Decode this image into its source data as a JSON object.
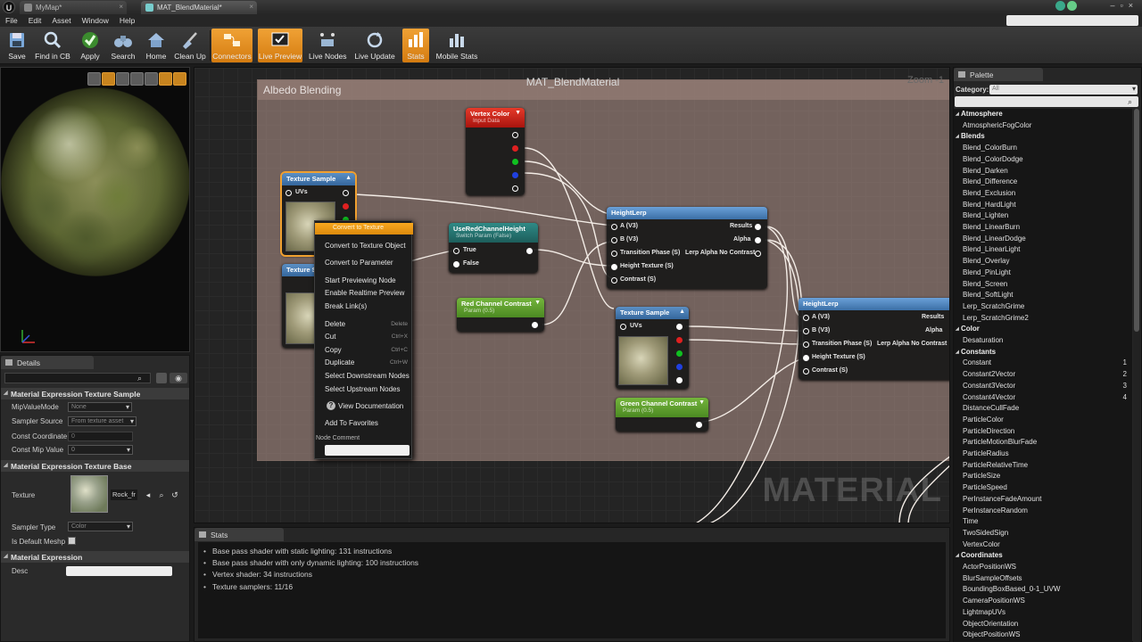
{
  "tabs": [
    {
      "label": "MyMap*"
    },
    {
      "label": "MAT_BlendMaterial*"
    }
  ],
  "menu": [
    "File",
    "Edit",
    "Asset",
    "Window",
    "Help"
  ],
  "toolbar": [
    {
      "label": "Save",
      "icon": "save-icon",
      "active": false
    },
    {
      "label": "Find in CB",
      "icon": "magnifier-icon",
      "active": false
    },
    {
      "label": "Apply",
      "icon": "checkmark-icon",
      "active": false
    },
    {
      "label": "Search",
      "icon": "binoculars-icon",
      "active": false
    },
    {
      "label": "Home",
      "icon": "home-icon",
      "active": false
    },
    {
      "label": "Clean Up",
      "icon": "broom-icon",
      "active": false
    },
    {
      "label": "Connectors",
      "icon": "connectors-icon",
      "active": true
    },
    {
      "label": "Live Preview",
      "icon": "live-preview-icon",
      "active": true
    },
    {
      "label": "Live Nodes",
      "icon": "live-nodes-icon",
      "active": false
    },
    {
      "label": "Live Update",
      "icon": "live-update-icon",
      "active": false
    },
    {
      "label": "Stats",
      "icon": "stats-icon",
      "active": true
    },
    {
      "label": "Mobile Stats",
      "icon": "mobile-stats-icon",
      "active": false
    }
  ],
  "details": {
    "tab": "Details",
    "sections": {
      "texture_sample": "Material Expression Texture Sample",
      "texture_base": "Material Expression Texture Base",
      "expression": "Material Expression"
    },
    "props": {
      "mip_value_mode": {
        "label": "MipValueMode",
        "value": "None"
      },
      "sampler_source": {
        "label": "Sampler Source",
        "value": "From texture asset"
      },
      "const_coordinate": {
        "label": "Const Coordinate",
        "value": "0"
      },
      "const_mip_value": {
        "label": "Const Mip Value",
        "value": "0"
      },
      "texture": {
        "label": "Texture",
        "value": "Rock_fr"
      },
      "sampler_type": {
        "label": "Sampler Type",
        "value": "Color"
      },
      "is_default_meshpaint": {
        "label": "Is Default Meshp"
      },
      "desc": {
        "label": "Desc",
        "value": ""
      }
    }
  },
  "graph": {
    "title": "MAT_BlendMaterial",
    "zoom": "Zoom -1",
    "comment": "Albedo Blending",
    "watermark": "MATERIAL",
    "nodes": {
      "vertex_color": {
        "title": "Vertex Color",
        "sub": "Input Data"
      },
      "texture_sample_1": {
        "title": "Texture Sample",
        "pin": "UVs"
      },
      "texture_sample_2": {
        "title": "Texture Sample"
      },
      "use_red": {
        "title": "UseRedChannelHeight",
        "sub": "Switch Param (False)",
        "pins": [
          "True",
          "False"
        ]
      },
      "red_contrast": {
        "title": "Red Channel Contrast",
        "sub": "Param (0.5)"
      },
      "height_lerp_1": {
        "title": "HeightLerp",
        "inputs": [
          "A (V3)",
          "B (V3)",
          "Transition Phase (S)",
          "Height Texture (S)",
          "Contrast (S)"
        ],
        "outputs": [
          "Results",
          "Alpha",
          "Lerp Alpha No Contrast"
        ]
      },
      "texture_sample_3": {
        "title": "Texture Sample",
        "pin": "UVs"
      },
      "green_contrast": {
        "title": "Green Channel Contrast",
        "sub": "Param (0.5)"
      },
      "height_lerp_2": {
        "title": "HeightLerp",
        "inputs": [
          "A (V3)",
          "B (V3)",
          "Transition Phase (S)",
          "Height Texture (S)",
          "Contrast (S)"
        ],
        "outputs": [
          "Results",
          "Alpha",
          "Lerp Alpha No Contrast"
        ]
      }
    }
  },
  "context_menu": {
    "header": "Convert to Texture",
    "items": [
      {
        "label": "Convert to Texture Object",
        "key": ""
      },
      {
        "label": "Convert to Parameter",
        "key": ""
      },
      {
        "label": "Start Previewing Node",
        "key": ""
      },
      {
        "label": "Enable Realtime Preview",
        "key": ""
      },
      {
        "label": "Break Link(s)",
        "key": ""
      },
      {
        "label": "Delete",
        "key": "Delete"
      },
      {
        "label": "Cut",
        "key": "Ctrl+X"
      },
      {
        "label": "Copy",
        "key": "Ctrl+C"
      },
      {
        "label": "Duplicate",
        "key": "Ctrl+W"
      },
      {
        "label": "Select Downstream Nodes",
        "key": ""
      },
      {
        "label": "Select Upstream Nodes",
        "key": ""
      },
      {
        "label": "View Documentation",
        "key": ""
      },
      {
        "label": "Add To Favorites",
        "key": ""
      }
    ],
    "comment_label": "Node Comment"
  },
  "stats": {
    "tab": "Stats",
    "lines": [
      "Base pass shader with static lighting: 131 instructions",
      "Base pass shader with only dynamic lighting: 100 instructions",
      "Vertex shader: 34 instructions",
      "Texture samplers: 11/16"
    ]
  },
  "palette": {
    "tab": "Palette",
    "category_label": "Category:",
    "category_value": "All",
    "rows": [
      {
        "type": "cat",
        "label": "Atmosphere"
      },
      {
        "type": "item",
        "label": "AtmosphericFogColor"
      },
      {
        "type": "cat",
        "label": "Blends"
      },
      {
        "type": "item",
        "label": "Blend_ColorBurn"
      },
      {
        "type": "item",
        "label": "Blend_ColorDodge"
      },
      {
        "type": "item",
        "label": "Blend_Darken"
      },
      {
        "type": "item",
        "label": "Blend_Difference"
      },
      {
        "type": "item",
        "label": "Blend_Exclusion"
      },
      {
        "type": "item",
        "label": "Blend_HardLight"
      },
      {
        "type": "item",
        "label": "Blend_Lighten"
      },
      {
        "type": "item",
        "label": "Blend_LinearBurn"
      },
      {
        "type": "item",
        "label": "Blend_LinearDodge"
      },
      {
        "type": "item",
        "label": "Blend_LinearLight"
      },
      {
        "type": "item",
        "label": "Blend_Overlay"
      },
      {
        "type": "item",
        "label": "Blend_PinLight"
      },
      {
        "type": "item",
        "label": "Blend_Screen"
      },
      {
        "type": "item",
        "label": "Blend_SoftLight"
      },
      {
        "type": "item",
        "label": "Lerp_ScratchGrime"
      },
      {
        "type": "item",
        "label": "Lerp_ScratchGrime2"
      },
      {
        "type": "cat",
        "label": "Color"
      },
      {
        "type": "item",
        "label": "Desaturation"
      },
      {
        "type": "cat",
        "label": "Constants"
      },
      {
        "type": "item",
        "label": "Constant",
        "key": "1"
      },
      {
        "type": "item",
        "label": "Constant2Vector",
        "key": "2"
      },
      {
        "type": "item",
        "label": "Constant3Vector",
        "key": "3"
      },
      {
        "type": "item",
        "label": "Constant4Vector",
        "key": "4"
      },
      {
        "type": "item",
        "label": "DistanceCullFade"
      },
      {
        "type": "item",
        "label": "ParticleColor"
      },
      {
        "type": "item",
        "label": "ParticleDirection"
      },
      {
        "type": "item",
        "label": "ParticleMotionBlurFade"
      },
      {
        "type": "item",
        "label": "ParticleRadius"
      },
      {
        "type": "item",
        "label": "ParticleRelativeTime"
      },
      {
        "type": "item",
        "label": "ParticleSize"
      },
      {
        "type": "item",
        "label": "ParticleSpeed"
      },
      {
        "type": "item",
        "label": "PerInstanceFadeAmount"
      },
      {
        "type": "item",
        "label": "PerInstanceRandom"
      },
      {
        "type": "item",
        "label": "Time"
      },
      {
        "type": "item",
        "label": "TwoSidedSign"
      },
      {
        "type": "item",
        "label": "VertexColor"
      },
      {
        "type": "cat",
        "label": "Coordinates"
      },
      {
        "type": "item",
        "label": "ActorPositionWS"
      },
      {
        "type": "item",
        "label": "BlurSampleOffsets"
      },
      {
        "type": "item",
        "label": "BoundingBoxBased_0-1_UVW"
      },
      {
        "type": "item",
        "label": "CameraPositionWS"
      },
      {
        "type": "item",
        "label": "LightmapUVs"
      },
      {
        "type": "item",
        "label": "ObjectOrientation"
      },
      {
        "type": "item",
        "label": "ObjectPositionWS"
      }
    ]
  },
  "colors": {
    "accent": "#e8901c",
    "canvas": "#242424",
    "comment": "#b4968c"
  }
}
